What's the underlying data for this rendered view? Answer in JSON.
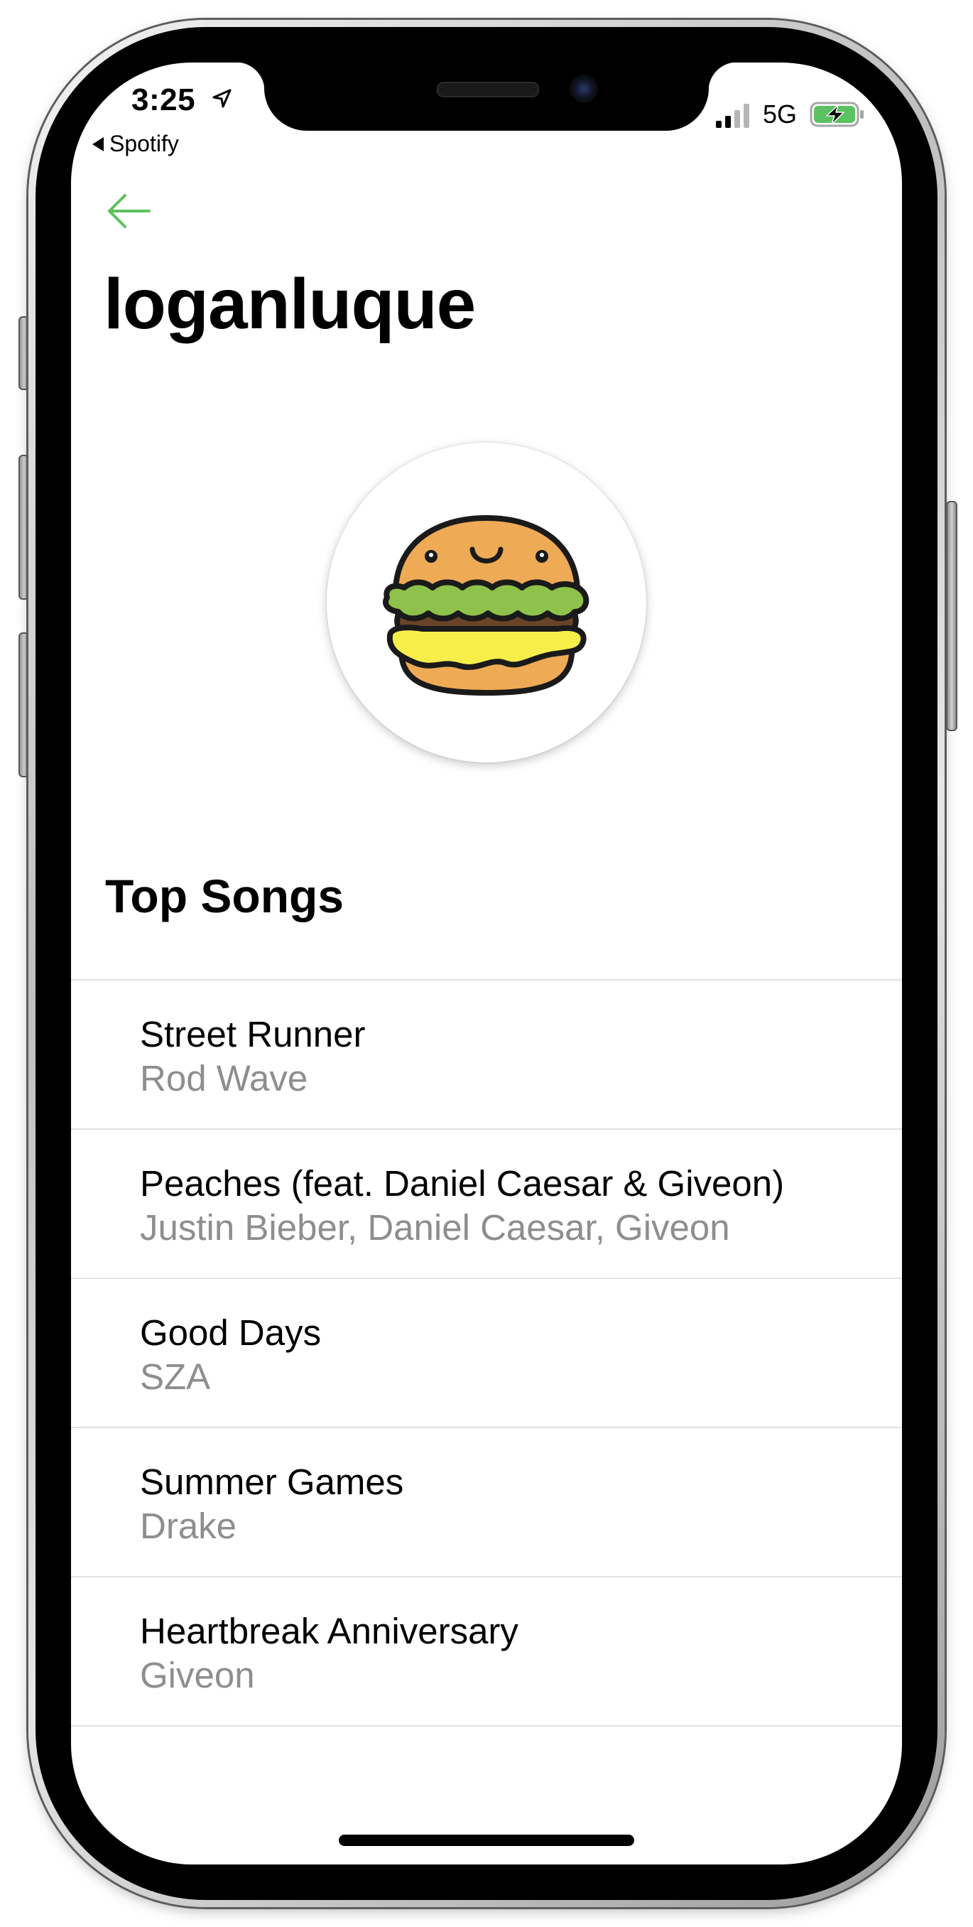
{
  "status_bar": {
    "time": "3:25",
    "back_app": "Spotify",
    "network": "5G",
    "icons": [
      "location-arrow-icon",
      "signal-icon",
      "battery-charging-icon"
    ]
  },
  "header": {
    "back_icon": "arrow-left-icon",
    "title": "loganluque"
  },
  "profile": {
    "avatar_icon": "burger-avatar"
  },
  "top_songs": {
    "heading": "Top Songs",
    "songs": [
      {
        "title": "Street Runner",
        "artist": "Rod Wave"
      },
      {
        "title": "Peaches (feat. Daniel Caesar & Giveon)",
        "artist": "Justin Bieber, Daniel Caesar, Giveon"
      },
      {
        "title": "Good Days",
        "artist": "SZA"
      },
      {
        "title": "Summer Games",
        "artist": "Drake"
      },
      {
        "title": "Heartbreak Anniversary",
        "artist": "Giveon"
      }
    ]
  },
  "colors": {
    "accent": "#5cc160",
    "text_primary": "#000000",
    "text_secondary": "#8e8e8e",
    "divider": "#e2e2e2",
    "battery_fill": "#5cc160"
  }
}
